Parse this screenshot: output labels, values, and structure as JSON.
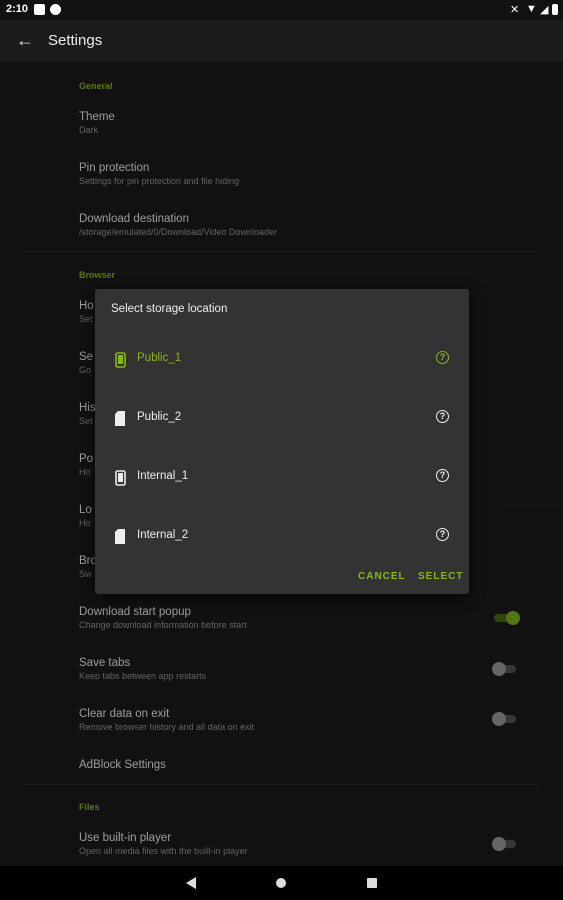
{
  "status_bar": {
    "time": "2:10"
  },
  "app_bar": {
    "title": "Settings"
  },
  "sections": {
    "general": "General",
    "browser": "Browser",
    "files": "Files"
  },
  "general_items": [
    {
      "title": "Theme",
      "subtitle": "Dark"
    },
    {
      "title": "Pin protection",
      "subtitle": "Settings for pin protection and file hiding"
    },
    {
      "title": "Download destination",
      "subtitle": "/storage/emulated/0/Download/Video Downloader"
    }
  ],
  "browser_items_hidden": [
    {
      "title": "Ho",
      "subtitle": "Set"
    },
    {
      "title": "Se",
      "subtitle": "Go"
    },
    {
      "title": "His",
      "subtitle": "Set"
    },
    {
      "title": "Po",
      "subtitle": "Ho"
    },
    {
      "title": "Lo",
      "subtitle": "Ho"
    },
    {
      "title": "Bro",
      "subtitle": "Sw"
    }
  ],
  "browser_items": [
    {
      "title": "Download start popup",
      "subtitle": "Change download information before start",
      "enabled": true
    },
    {
      "title": "Save tabs",
      "subtitle": "Keep tabs between app restarts",
      "enabled": false
    },
    {
      "title": "Clear data on exit",
      "subtitle": "Remove browser history and all data on exit",
      "enabled": false
    },
    {
      "title": "AdBlock Settings"
    }
  ],
  "files_items": [
    {
      "title": "Use built-in player",
      "subtitle": "Open all media files with the built-in player",
      "enabled": false
    }
  ],
  "dialog": {
    "title": "Select storage location",
    "options": [
      {
        "label": "Public_1",
        "icon": "phone-icon",
        "selected": true
      },
      {
        "label": "Public_2",
        "icon": "sd-card-icon",
        "selected": false
      },
      {
        "label": "Internal_1",
        "icon": "phone-icon",
        "selected": false
      },
      {
        "label": "Internal_2",
        "icon": "sd-card-icon",
        "selected": false
      }
    ],
    "help_glyph": "?",
    "cancel_label": "CANCEL",
    "select_label": "SELECT"
  },
  "colors": {
    "accent": "#8ab41f",
    "background": "#1b1b1b",
    "dialog": "#333333"
  }
}
